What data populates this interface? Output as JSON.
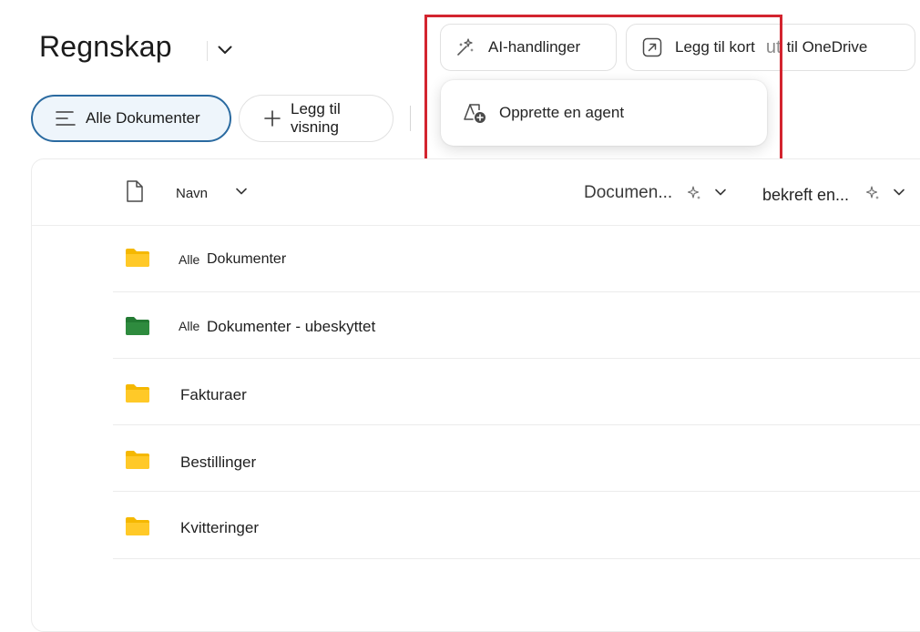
{
  "header": {
    "title": "Regnskap",
    "ai_actions_label": "AI-handlinger",
    "add_card_label": "Legg til kort",
    "ghost_ut": "ut",
    "ghost_onedrive": "til OneDrive"
  },
  "dropdown": {
    "create_agent_label": "Opprette en agent"
  },
  "views": {
    "all_documents_label": "Alle Dokumenter",
    "add_view_label": "Legg til visning"
  },
  "table": {
    "columns": {
      "name": "Navn",
      "document": "Documen...",
      "confirm": "bekreft en..."
    },
    "rows": [
      {
        "prefix": "Alle",
        "name": "Dokumenter",
        "folder_color": "#f5b800"
      },
      {
        "prefix": "Alle",
        "name": "Dokumenter - ubeskyttet",
        "folder_color": "#2e8b3e"
      },
      {
        "prefix": "",
        "name": "Fakturaer",
        "folder_color": "#f5b800"
      },
      {
        "prefix": "",
        "name": "Bestillinger",
        "folder_color": "#f5b800"
      },
      {
        "prefix": "",
        "name": "Kvitteringer",
        "folder_color": "#f5b800"
      }
    ]
  },
  "colors": {
    "highlight": "#d3242f",
    "accent": "#2a6aa0",
    "folder_yellow": "#f5b800",
    "folder_green": "#2e8b3e"
  }
}
